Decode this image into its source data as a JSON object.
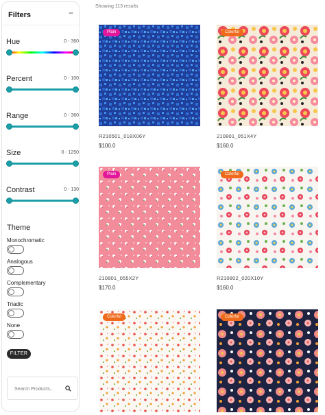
{
  "sidebar": {
    "title": "Filters",
    "collapse_icon": "minus-icon",
    "filters": [
      {
        "label": "Hue",
        "min": "0",
        "max": "360",
        "range": "0 - 360"
      },
      {
        "label": "Percent",
        "min": "0",
        "max": "100",
        "range": "0 - 100"
      },
      {
        "label": "Range",
        "min": "0",
        "max": "360",
        "range": "0 - 360"
      },
      {
        "label": "Size",
        "min": "0",
        "max": "1250",
        "range": "0 - 1250"
      },
      {
        "label": "Contrast",
        "min": "0",
        "max": "130",
        "range": "0 - 130"
      }
    ],
    "theme": {
      "label": "Theme",
      "options": [
        {
          "label": "Monochromatic",
          "on": false
        },
        {
          "label": "Analogous",
          "on": false
        },
        {
          "label": "Complementary",
          "on": false
        },
        {
          "label": "Triadic",
          "on": false
        },
        {
          "label": "None",
          "on": false
        }
      ]
    },
    "filter_button": "FILTER",
    "search": {
      "placeholder": "Search Products...",
      "value": "",
      "icon": "search-icon"
    }
  },
  "main": {
    "results_text": "Showing 113 results",
    "products": [
      {
        "badge": "Plain",
        "name": "R210501_018X06Y",
        "price": "$100.0",
        "pattern": "blue-squares"
      },
      {
        "badge": "Colorful",
        "name": "210801_051X4Y",
        "price": "$160.0",
        "pattern": "pink-flowers"
      },
      {
        "badge": "Plain",
        "name": "210801_055X2Y",
        "price": "$170.0",
        "pattern": "pink-ditsy"
      },
      {
        "badge": "Colorful",
        "name": "R210802_020X10Y",
        "price": "$160.0",
        "pattern": "multi-flowers"
      },
      {
        "badge": "Colorful",
        "name": "",
        "price": "",
        "pattern": "white-ditsy"
      },
      {
        "badge": "Colorful",
        "name": "",
        "price": "",
        "pattern": "navy-flowers"
      }
    ]
  },
  "colors": {
    "accent": "#1a9fa8",
    "plain_badge": "#e3179b",
    "colorful_badge": "#ef6a1a",
    "button": "#2b2b2b"
  }
}
